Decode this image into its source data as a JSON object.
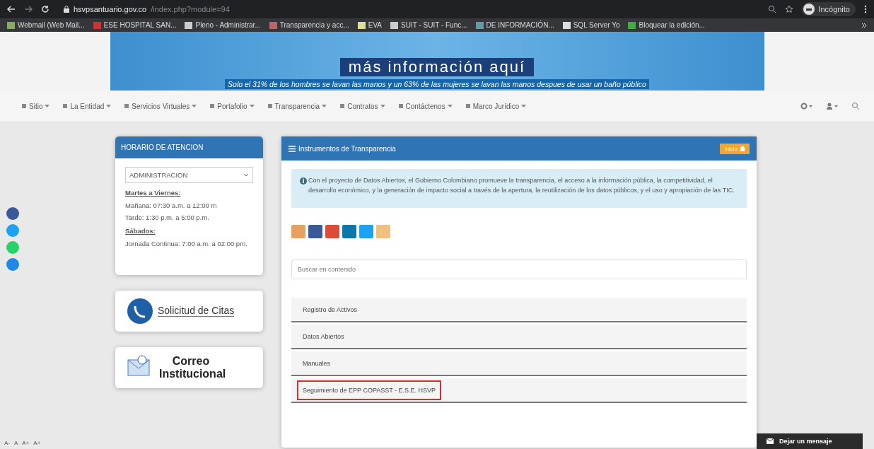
{
  "browser": {
    "url_host": "hsvpsantuario.gov.co",
    "url_path": "/index.php?module=94",
    "profile": "Incógnito",
    "bookmarks": [
      {
        "label": "Webmail (Web Mail..."
      },
      {
        "label": "ESE HOSPITAL SAN..."
      },
      {
        "label": "Pleno - Administrar..."
      },
      {
        "label": "Transparencia y acc..."
      },
      {
        "label": "EVA"
      },
      {
        "label": "SUIT - SUIT - Func..."
      },
      {
        "label": "DE INFORMACIÓN..."
      },
      {
        "label": "SQL Server Yo"
      },
      {
        "label": "Bloquear la edición..."
      }
    ]
  },
  "banner": {
    "headline": "más información aquí",
    "caption": "Solo el 31% de los hombres se lavan las manos y un 63% de las mujeres se lavan las manos despues de usar un baño público"
  },
  "nav": {
    "items": [
      {
        "label": "Sitio"
      },
      {
        "label": "La Entidad"
      },
      {
        "label": "Servicios Virtuales"
      },
      {
        "label": "Portafolio"
      },
      {
        "label": "Transparencia"
      },
      {
        "label": "Contratos"
      },
      {
        "label": "Contáctenos"
      },
      {
        "label": "Marco Jurídico"
      }
    ]
  },
  "schedule": {
    "title": "HORARIO DE ATENCION",
    "select_value": "ADMINISTRACION",
    "blocks": [
      {
        "heading": "Martes a Viernes:",
        "lines": [
          "Mañana: 07:30 a.m. a 12:00 m",
          "Tarde: 1:30 p.m. a 5:00 p.m."
        ]
      },
      {
        "heading": "Sábados:",
        "lines": [
          "Jornada Continua: 7:00 a.m. a 02:00 pm."
        ]
      }
    ]
  },
  "promos": [
    {
      "kind": "citas",
      "label": "Solicitud de Citas"
    },
    {
      "kind": "correo",
      "label": "Correo Institucional"
    }
  ],
  "panel": {
    "title": "Instrumentos de Transparencia",
    "home_button": "Inicio",
    "info": "Con el proyecto de Datos Abiertos, el Gobierno Colombiano promueve la transparencia, el acceso a la información pública, la competitividad, el desarrollo económico, y la generación de impacto social a través de la apertura, la reutilización de los datos públicos, y el uso y apropiación de las TIC.",
    "search": {
      "placeholder": "Buscar en contenido"
    },
    "items": [
      {
        "label": "Registro de Activos",
        "highlighted": false
      },
      {
        "label": "Datos Abiertos",
        "highlighted": false
      },
      {
        "label": "Manuales",
        "highlighted": false
      },
      {
        "label": "Seguimiento de EPP COPASST - E.S.E. HSVP",
        "highlighted": true
      }
    ]
  },
  "font_controls": [
    "A-",
    "A",
    "A+",
    "A+"
  ],
  "chat_button": "Dejar un mensaje"
}
